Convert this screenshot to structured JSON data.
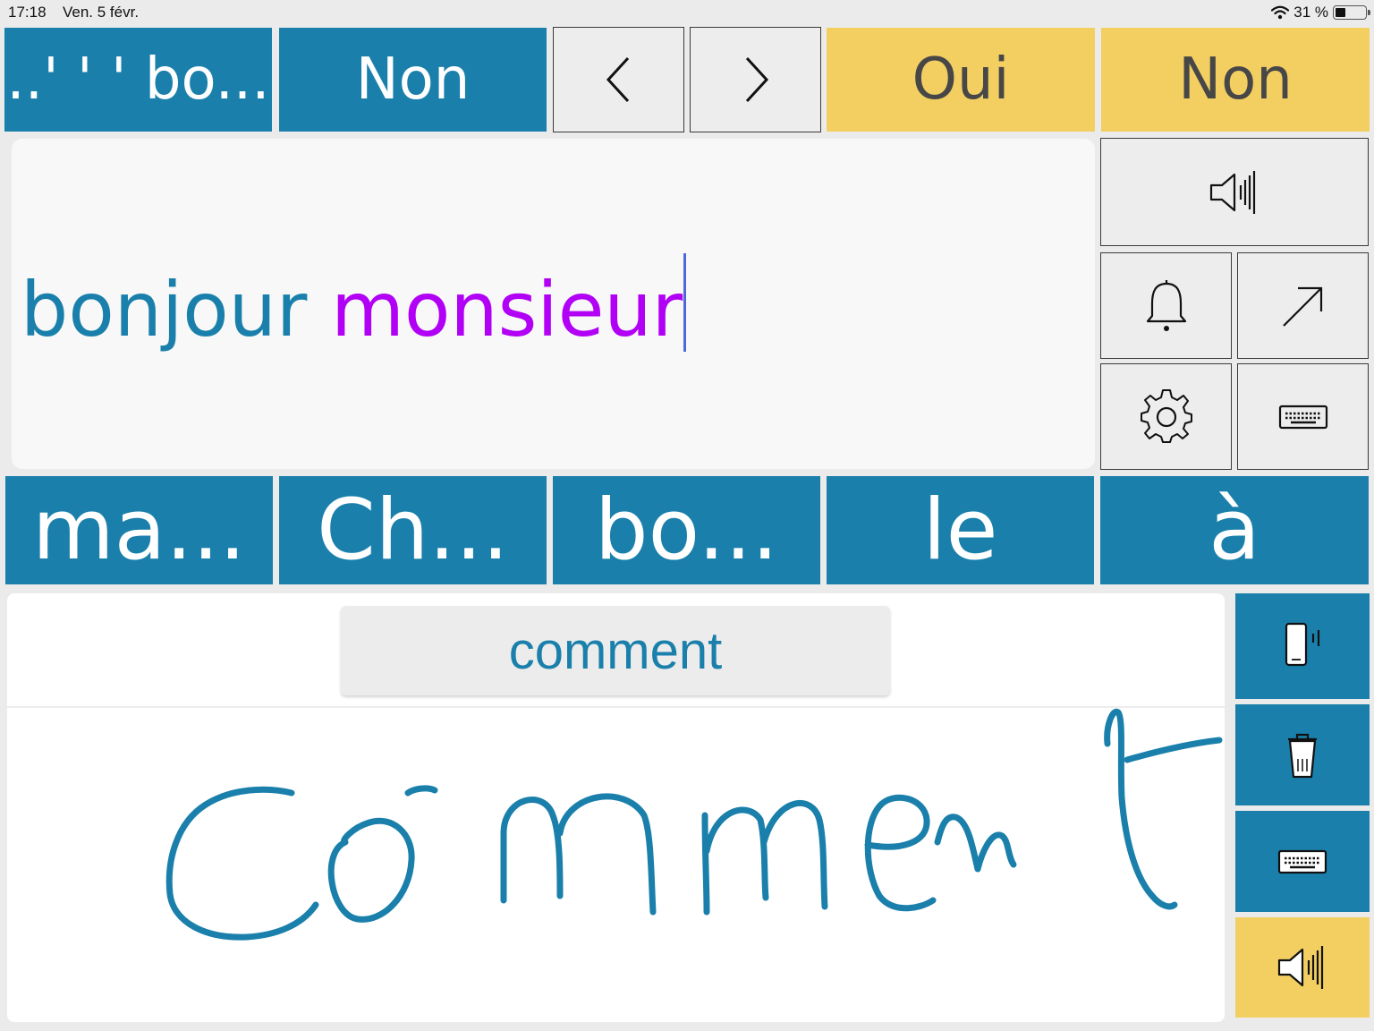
{
  "status_bar": {
    "time": "17:18",
    "date": "Ven. 5 févr.",
    "battery": "31 %"
  },
  "top_row": {
    "history_label": "..' ' ' bo...",
    "non_blue_label": "Non",
    "oui_label": "Oui",
    "non_yellow_label": "Non"
  },
  "text_area": {
    "word1": "bonjour",
    "word2": "monsieur"
  },
  "predictions": [
    "ma...",
    "Ch...",
    "bo...",
    "le",
    "à"
  ],
  "handwriting": {
    "suggestion": "comment"
  },
  "icons": {
    "nav_prev": "chevron-left-icon",
    "nav_next": "chevron-right-icon",
    "speak": "speaker-icon",
    "alert": "bell-icon",
    "share": "arrow-up-right-icon",
    "settings": "gear-icon",
    "keyboard": "keyboard-icon",
    "vibrate": "phone-vibrate-icon",
    "delete": "trash-icon"
  },
  "colors": {
    "blue": "#1a80ab",
    "yellow": "#f3cf62",
    "purple": "#b100f5"
  }
}
